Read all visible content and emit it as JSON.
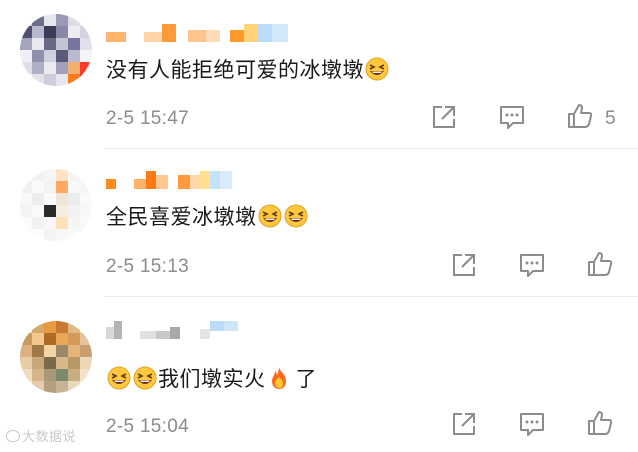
{
  "comments": [
    {
      "text": "没有人能拒绝可爱的冰墩墩",
      "time": "2-5 15:47",
      "like_count": "5"
    },
    {
      "text": "全民喜爱冰墩墩",
      "time": "2-5 15:13",
      "like_count": ""
    },
    {
      "text_after_emoji": "我们墩实火",
      "text_end": "了",
      "time": "2-5 15:04",
      "like_count": ""
    }
  ],
  "icons": {
    "share": "share-icon",
    "comment": "comment-icon",
    "like": "like-icon",
    "laugh_emoji": "laughing-emoji-icon",
    "fire_emoji": "fire-emoji-icon"
  },
  "colors": {
    "text": "#1a1a1a",
    "meta": "#8c8c8c",
    "name_orange": "#ff8a1f",
    "name_blue": "#8fc4f5"
  },
  "watermark": "大数据说"
}
